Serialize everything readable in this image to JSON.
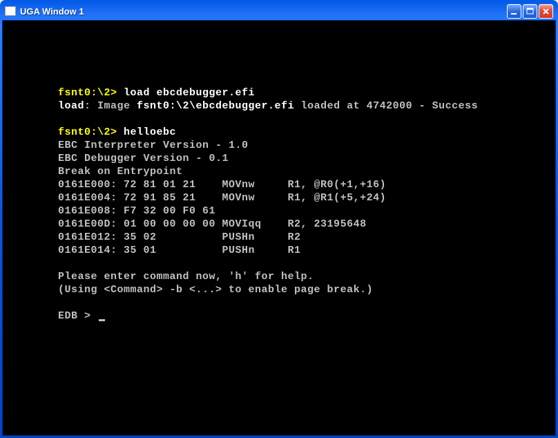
{
  "window": {
    "title": "UGA Window 1"
  },
  "terminal": {
    "prompt1_path": "fsnt0:\\2>",
    "prompt1_cmd": "load ebcdebugger.efi",
    "load_label": "load",
    "load_mid1": ": Image ",
    "load_path": "fsnt0:\\2\\ebcdebugger.efi",
    "load_mid2": " loaded at 4742000 - Success",
    "prompt2_path": "fsnt0:\\2>",
    "prompt2_cmd": "helloebc",
    "info1": "EBC Interpreter Version - 1.0",
    "info2": "EBC Debugger Version - 0.1",
    "info3": "Break on Entrypoint",
    "disasm": [
      "0161E000: 72 81 01 21    MOVnw     R1, @R0(+1,+16)",
      "0161E004: 72 91 85 21    MOVnw     R1, @R1(+5,+24)",
      "0161E008: F7 32 00 F0 61",
      "0161E00D: 01 00 00 00 00 MOVIqq    R2, 23195648",
      "0161E012: 35 02          PUSHn     R2",
      "0161E014: 35 01          PUSHn     R1"
    ],
    "help1": "Please enter command now, 'h' for help.",
    "help2": "(Using <Command> -b <...> to enable page break.)",
    "edb_prompt": "EDB > "
  }
}
